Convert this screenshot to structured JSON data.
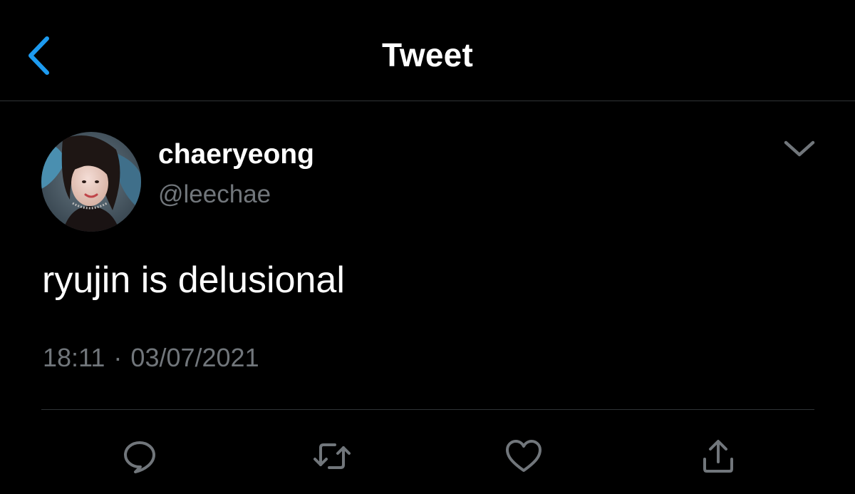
{
  "header": {
    "title": "Tweet",
    "back_icon": "chevron-left-icon"
  },
  "tweet": {
    "author": {
      "name": "chaeryeong",
      "handle": "@leechae",
      "avatar": "profile-photo"
    },
    "text": "ryujin is delusional",
    "time": "18:11",
    "separator": "·",
    "date": "03/07/2021",
    "more_icon": "chevron-down-icon"
  },
  "actions": [
    {
      "name": "reply",
      "icon": "reply-icon"
    },
    {
      "name": "retweet",
      "icon": "retweet-icon"
    },
    {
      "name": "like",
      "icon": "heart-icon"
    },
    {
      "name": "share",
      "icon": "share-icon"
    }
  ],
  "colors": {
    "background": "#000000",
    "text_primary": "#ffffff",
    "text_secondary": "#71767b",
    "accent": "#1d9bf0",
    "divider": "#2f3336"
  }
}
